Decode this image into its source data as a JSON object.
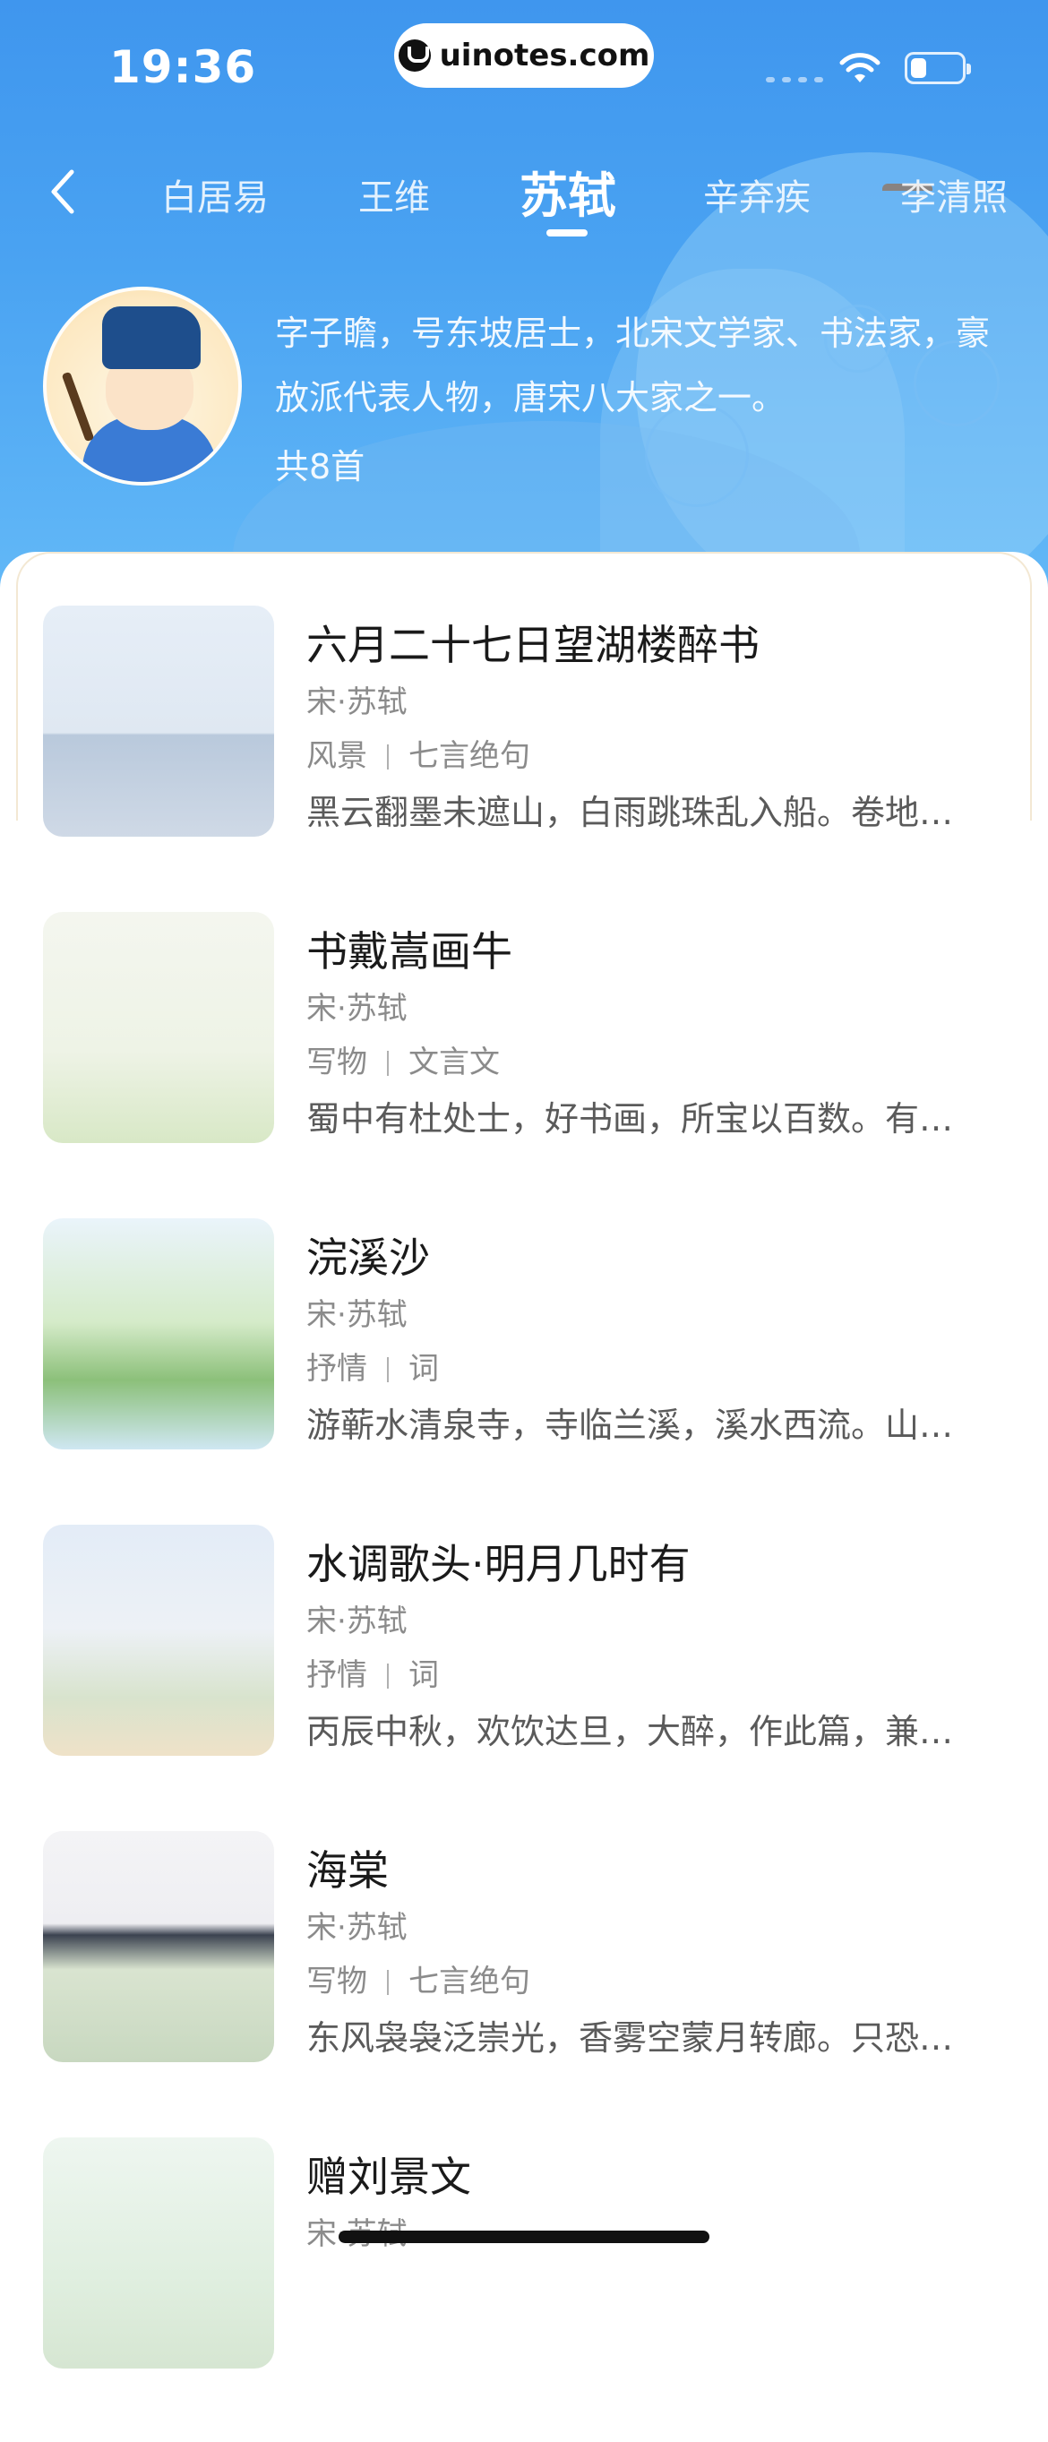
{
  "status_bar": {
    "time": "19:36",
    "url_pill": "uinotes.com",
    "battery_level": 0.3
  },
  "tabs": [
    {
      "label": "白居易",
      "active": false
    },
    {
      "label": "王维",
      "active": false
    },
    {
      "label": "苏轼",
      "active": true
    },
    {
      "label": "辛弃疾",
      "active": false
    },
    {
      "label": "李清照",
      "active": false
    }
  ],
  "poet": {
    "intro": "字子瞻，号东坡居士，北宋文学家、书法家，豪放派代表人物，唐宋八大家之一。",
    "count": "共8首"
  },
  "poems": [
    {
      "title": "六月二十七日望湖楼醉书",
      "author": "宋·苏轼",
      "tag1": "风景",
      "tag2": "七言绝句",
      "excerpt": "黑云翻墨未遮山，白雨跳珠乱入船。卷地风来忽吹散，望湖楼下水如天。",
      "thumb": "pavilion-scene"
    },
    {
      "title": "书戴嵩画牛",
      "author": "宋·苏轼",
      "tag1": "写物",
      "tag2": "文言文",
      "excerpt": "蜀中有杜处士，好书画，所宝以百数。有戴嵩牛一轴，尤所爱。",
      "thumb": "two-scholars-painting"
    },
    {
      "title": "浣溪沙",
      "author": "宋·苏轼",
      "tag1": "抒情",
      "tag2": "词",
      "excerpt": "游蕲水清泉寺，寺临兰溪，溪水西流。山下兰芽短浸溪。",
      "thumb": "temple-stream"
    },
    {
      "title": "水调歌头·明月几时有",
      "author": "宋·苏轼",
      "tag1": "抒情",
      "tag2": "词",
      "excerpt": "丙辰中秋，欢饮达旦，大醉，作此篇，兼怀子由。",
      "thumb": "moon-scholar"
    },
    {
      "title": "海棠",
      "author": "宋·苏轼",
      "tag1": "写物",
      "tag2": "七言绝句",
      "excerpt": "东风袅袅泛崇光，香雾空蒙月转廊。只恐夜深花睡去。",
      "thumb": "crabapple-garden"
    },
    {
      "title": "赠刘景文",
      "author": "宋·苏轼",
      "tag1": "",
      "tag2": "",
      "excerpt": "",
      "thumb": "autumn-orange"
    }
  ],
  "colors": {
    "hero_blue": "#4aa3f2",
    "text_primary": "#1a1a1a",
    "text_secondary": "#8b8b8b"
  }
}
